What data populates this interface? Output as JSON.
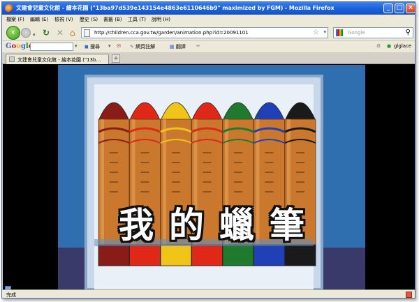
{
  "window": {
    "title": "文建會兒童文化館 - 繪本花園 (\"13ba97d539e143154e4863e6110646b9\" maximized by FGM) - Mozilla Firefox",
    "buttons": {
      "minimize": "_",
      "maximize": "□",
      "close": "×"
    }
  },
  "menubar": {
    "items": [
      "檔案 (F)",
      "編輯 (E)",
      "檢視 (V)",
      "歷史 (S)",
      "書籤 (B)",
      "工具 (T)",
      "說明 (H)"
    ]
  },
  "navigation": {
    "url": "http://children.cca.gov.tw/garden/animation.php?id=20091101",
    "search_placeholder": "Google"
  },
  "google_toolbar": {
    "logo_letters": [
      "G",
      "o",
      "o",
      "g",
      "l",
      "e"
    ],
    "search_label": "搜尋",
    "annotate_label": "網頁註解",
    "translate_label": "翻譯",
    "account_label": "glglace"
  },
  "tab": {
    "title": "文建會兒童文化館 - 繪本花園 (\"13b…"
  },
  "content": {
    "caption_chars": [
      "我",
      "的",
      "蠟",
      "筆"
    ],
    "crayon_colors": [
      "#8a1c18",
      "#e02818",
      "#f0c418",
      "#e02818",
      "#1f7a2e",
      "#2040b8",
      "#1a1a1a"
    ],
    "background_color": "#2f6fb0"
  },
  "status": {
    "text": "完成"
  }
}
